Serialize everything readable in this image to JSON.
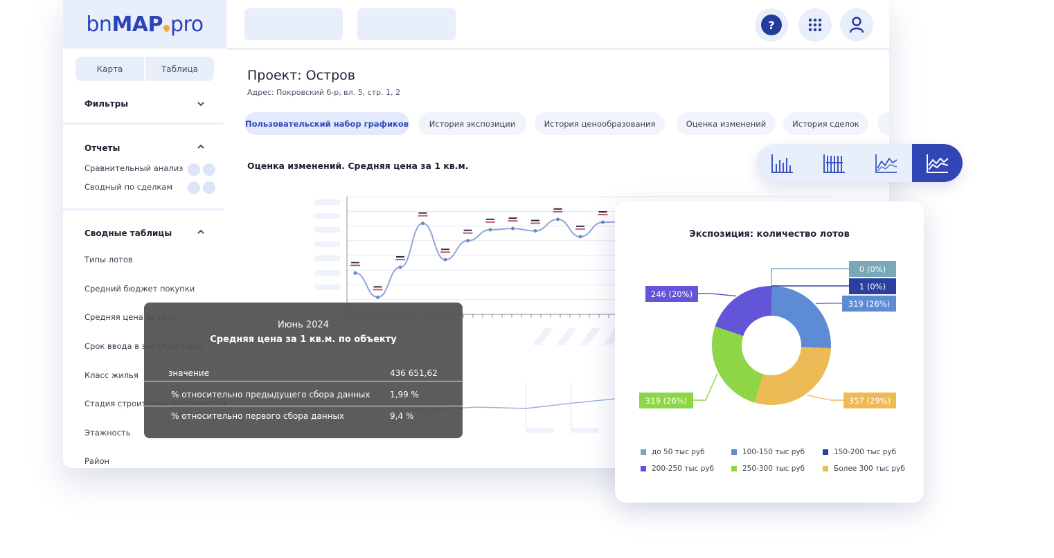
{
  "logo": {
    "part1": "bn",
    "part2": "MAP",
    "part3": "pro"
  },
  "sidebar": {
    "view_tabs": [
      "Карта",
      "Таблица"
    ],
    "filters_label": "Фильтры",
    "reports_label": "Отчеты",
    "reports": [
      "Сравнительный анализ",
      "Сводный по сделкам"
    ],
    "pivot_label": "Сводные таблицы",
    "pivot_items": [
      "Типы лотов",
      "Средний бюджет покупки",
      "Средняя цена за кв.м.",
      "Срок ввода в эксплуатацию",
      "Класс жилья",
      "Стадия строительной готовности",
      "Этажность",
      "Район"
    ]
  },
  "header": {
    "help_label": "?"
  },
  "project": {
    "title": "Проект: Остров",
    "address": "Адрес: Покровский б-р, вл. 5, стр. 1, 2"
  },
  "tabs": [
    "Пользовательский набор графиков",
    "История экспозиции",
    "История ценообразования",
    "Оценка изменений",
    "История сделок"
  ],
  "chart_title": "Оценка изменений. Средняя цена за 1 кв.м.",
  "tooltip": {
    "month": "Июнь 2024",
    "title": "Средняя цена за 1 кв.м. по объекту",
    "rows": [
      {
        "label": "значение",
        "value": "436 651,62"
      },
      {
        "label": "% относительно предыдущего сбора данных",
        "value": "1,99 %"
      },
      {
        "label": "% относительно первого сбора данных",
        "value": "9,4 %"
      }
    ]
  },
  "donut": {
    "title": "Экспозиция: количество лотов",
    "legend": [
      "до 50  тыс руб",
      "100-150  тыс руб",
      "150-200  тыс руб",
      "200-250  тыс руб",
      "250-300  тыс руб",
      "Более 300  тыс руб"
    ],
    "colors": [
      "#79a9b8",
      "#5d8bd4",
      "#2b3fa0",
      "#6355d7",
      "#8ed547",
      "#edbb55"
    ]
  },
  "chart_data": [
    {
      "type": "pie",
      "title": "Экспозиция: количество лотов",
      "categories": [
        "до 50  тыс руб",
        "100-150  тыс руб",
        "150-200  тыс руб",
        "200-250  тыс руб",
        "250-300  тыс руб",
        "Более 300  тыс руб"
      ],
      "values": [
        0,
        319,
        1,
        246,
        319,
        357
      ],
      "data_labels": [
        "0 (0%)",
        "319 (26%)",
        "1 (0%)",
        "246 (20%)",
        "319 (26%)",
        "357 (29%)"
      ],
      "legend_position": "bottom"
    },
    {
      "type": "line",
      "title": "Оценка изменений. Средняя цена за 1 кв.м.",
      "values": [
        402,
        360,
        412,
        488,
        425,
        458,
        477,
        479,
        475,
        495,
        465,
        490,
        491,
        485,
        497,
        496,
        497,
        496,
        505,
        505
      ],
      "grid": true
    }
  ]
}
